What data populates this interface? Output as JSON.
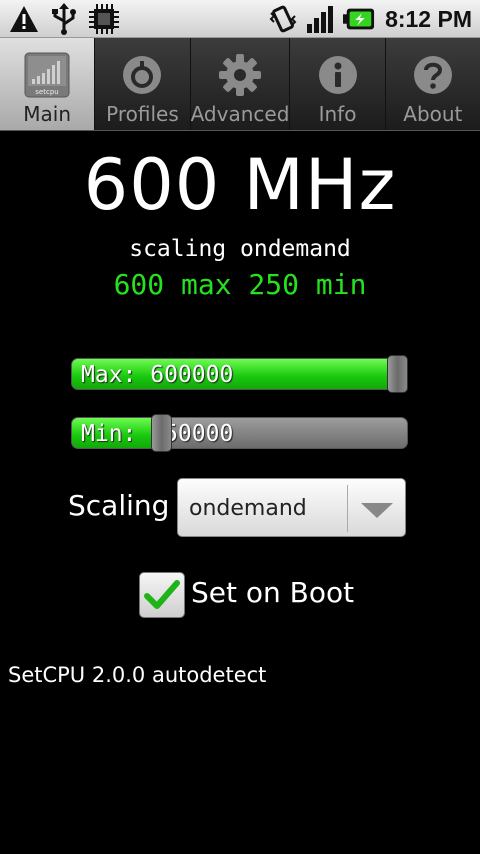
{
  "status_bar": {
    "time": "8:12 PM",
    "icons": [
      "warning-icon",
      "usb-icon",
      "chip-icon",
      "vibrate-icon",
      "signal-icon",
      "battery-charging-icon"
    ]
  },
  "tabs": [
    {
      "label": "Main",
      "icon": "setcpu-icon",
      "active": true
    },
    {
      "label": "Profiles",
      "icon": "profiles-icon",
      "active": false
    },
    {
      "label": "Advanced",
      "icon": "gear-icon",
      "active": false
    },
    {
      "label": "Info",
      "icon": "info-icon",
      "active": false
    },
    {
      "label": "About",
      "icon": "help-icon",
      "active": false
    }
  ],
  "main": {
    "frequency": "600 MHz",
    "scaling_line": "scaling ondemand",
    "range_line": "600 max 250 min",
    "max_slider": {
      "label": "Max: 600000",
      "fraction": 0.97
    },
    "min_slider": {
      "label": "Min: 250000",
      "fraction": 0.27
    },
    "scaling_label": "Scaling",
    "scaling_value": "ondemand",
    "set_on_boot_label": "Set on Boot",
    "set_on_boot_checked": true,
    "footer": "SetCPU 2.0.0 autodetect"
  },
  "colors": {
    "accent_green": "#25e21d",
    "background": "#000000"
  }
}
